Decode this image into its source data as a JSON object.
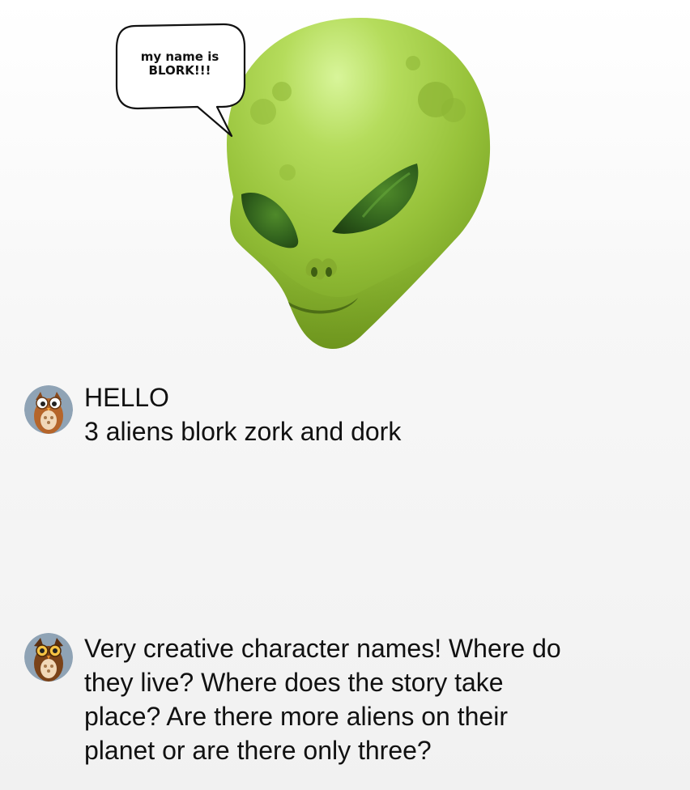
{
  "image": {
    "bubble_text": "my name is\nBLORK!!!",
    "alien_icon": "alien-head",
    "alien_color": "#9cc83a"
  },
  "messages": [
    {
      "avatar_icon": "owl-avatar",
      "text": "HELLO\n3 aliens blork zork and dork"
    },
    {
      "avatar_icon": "owl-avatar",
      "text": "Very creative character names! Where do\nthey live? Where does the story take\nplace? Are there more aliens on their\nplanet or are there only three?"
    }
  ]
}
